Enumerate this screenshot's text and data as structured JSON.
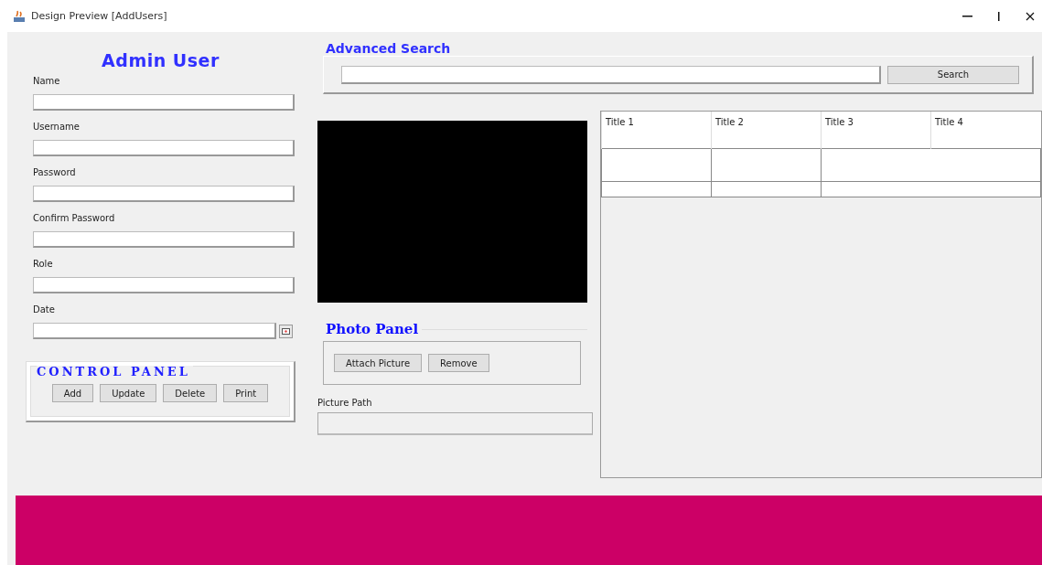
{
  "window": {
    "title": "Design Preview [AddUsers]"
  },
  "admin_form": {
    "title": "Admin User",
    "fields": [
      {
        "label": "Name",
        "kind": "text"
      },
      {
        "label": "Username",
        "kind": "text"
      },
      {
        "label": "Password",
        "kind": "text"
      },
      {
        "label": "Confirm Password",
        "kind": "text"
      },
      {
        "label": "Role",
        "kind": "text"
      },
      {
        "label": "Date",
        "kind": "date"
      }
    ]
  },
  "control_panel": {
    "title": "CONTROL PANEL",
    "buttons": [
      "Add",
      "Update",
      "Delete",
      "Print"
    ]
  },
  "advanced_search": {
    "title": "Advanced Search",
    "button": "Search"
  },
  "photo_panel": {
    "title": "Photo Panel",
    "buttons": [
      "Attach Picture",
      "Remove"
    ],
    "path_label": "Picture Path"
  },
  "table": {
    "columns": [
      "Title 1",
      "Title 2",
      "Title 3",
      "Title 4"
    ]
  }
}
